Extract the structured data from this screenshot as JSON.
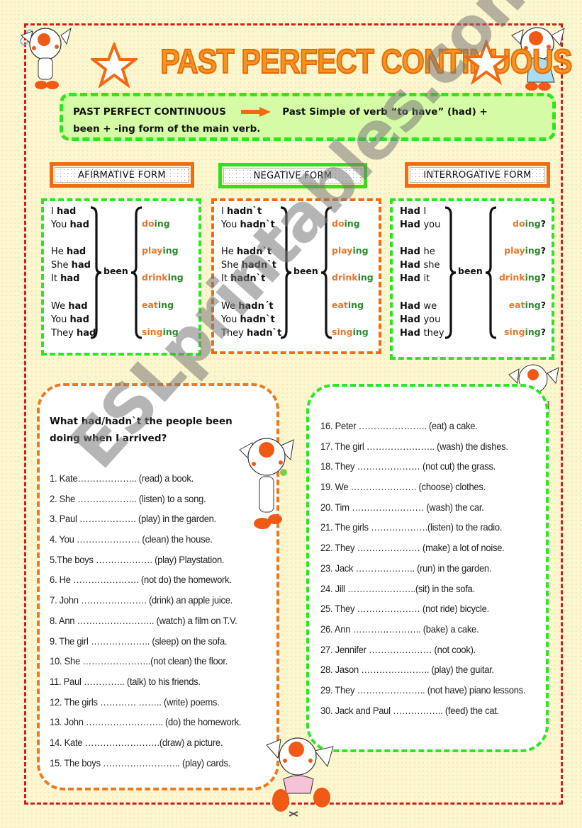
{
  "title": "PAST PERFECT CONTINUOUS",
  "rule": {
    "term": "PAST PERFECT CONTINUOUS",
    "arrow_icon": "right-arrow-icon",
    "definition_part1": "Past Simple of verb “to have” (had) +",
    "definition_part2": "been + -ing form of the main verb."
  },
  "colors": {
    "frame": "#d11f1f",
    "orange": "#f26a11",
    "green": "#2ee620",
    "title": "#f7941d",
    "verb_stem": "#e9772a",
    "verb_ing": "#2b8a2b",
    "rule_bg": "#d6fba6",
    "page_bg": "#fdf7cf"
  },
  "forms": {
    "affirmative": {
      "label": "AFIRMATIVE FORM",
      "subjects": [
        {
          "pronoun": "I",
          "aux": "had"
        },
        {
          "pronoun": "You",
          "aux": "had"
        },
        {
          "pronoun": "He",
          "aux": "had"
        },
        {
          "pronoun": "She",
          "aux": "had"
        },
        {
          "pronoun": "It",
          "aux": "had"
        },
        {
          "pronoun": "We",
          "aux": "had"
        },
        {
          "pronoun": "You",
          "aux": "had"
        },
        {
          "pronoun": "They",
          "aux": "had"
        }
      ],
      "been": "been",
      "verbs": [
        {
          "stem": "do",
          "ing": "ing",
          "q": ""
        },
        {
          "stem": "play",
          "ing": "ing",
          "q": ""
        },
        {
          "stem": "drink",
          "ing": "ing",
          "q": ""
        },
        {
          "stem": "eat",
          "ing": "ing",
          "q": ""
        },
        {
          "stem": "sing",
          "ing": "ing",
          "q": ""
        }
      ]
    },
    "negative": {
      "label": "NEGATIVE FORM",
      "subjects": [
        {
          "pronoun": "I",
          "aux": "hadn`t"
        },
        {
          "pronoun": "You",
          "aux": "hadn`t"
        },
        {
          "pronoun": "He",
          "aux": "hadn`t"
        },
        {
          "pronoun": "She",
          "aux": "hadn`t"
        },
        {
          "pronoun": "It",
          "aux": "hadn`t"
        },
        {
          "pronoun": "We",
          "aux": "hadn´t"
        },
        {
          "pronoun": "You",
          "aux": "hadn`t"
        },
        {
          "pronoun": "They",
          "aux": "hadn`t"
        }
      ],
      "been": "been",
      "verbs": [
        {
          "stem": "do",
          "ing": "ing",
          "q": ""
        },
        {
          "stem": "play",
          "ing": "ing",
          "q": ""
        },
        {
          "stem": "drink",
          "ing": "ing",
          "q": ""
        },
        {
          "stem": "eat",
          "ing": "ing",
          "q": ""
        },
        {
          "stem": "sing",
          "ing": "ing",
          "q": ""
        }
      ]
    },
    "interrogative": {
      "label": "INTERROGATIVE FORM",
      "subjects": [
        {
          "aux": "Had",
          "pronoun": "I"
        },
        {
          "aux": "Had",
          "pronoun": "you"
        },
        {
          "aux": "Had",
          "pronoun": "he"
        },
        {
          "aux": "Had",
          "pronoun": "she"
        },
        {
          "aux": "Had",
          "pronoun": "it"
        },
        {
          "aux": "Had",
          "pronoun": "we"
        },
        {
          "aux": "Had",
          "pronoun": "you"
        },
        {
          "aux": "Had",
          "pronoun": "they"
        }
      ],
      "been": "been",
      "verbs": [
        {
          "stem": "do",
          "ing": "ing",
          "q": "?"
        },
        {
          "stem": "play",
          "ing": "ing",
          "q": "?"
        },
        {
          "stem": "drink",
          "ing": "ing",
          "q": "?"
        },
        {
          "stem": "eat",
          "ing": "ing",
          "q": "?"
        },
        {
          "stem": "sing",
          "ing": "ing",
          "q": "?"
        }
      ]
    }
  },
  "exercise": {
    "instruction": "What had/hadn`t the people been doing when I arrived?",
    "items_left": [
      "1. Kate……………….. (read) a book.",
      "2. She ……………….. (listen) to a song.",
      "3. Paul ………………. (play)  in the garden.",
      "4. You ………………… (clean)  the house.",
      "5.The boys ………………. (play) Playstation.",
      "6. He …………………. (not do) the homework.",
      "7. John …………………. (drink) an apple juice.",
      "8. Ann …………………….. (watch) a film on T.V.",
      "9. The girl ………………..  (sleep) on the sofa.",
      "10. She …………………..(not clean) the floor.",
      "11. Paul …………..  (talk) to his friends.",
      "12. The girls ………… …….. (write) poems.",
      "13. John …………………….. (do) the homework.",
      "14. Kate …………………….(draw) a picture.",
      "15. The boys …………………….. (play) cards."
    ],
    "items_right": [
      "16. Peter …………………..  (eat) a cake.",
      "17. The girl ………………….. (wash) the dishes.",
      "18. They ………………… (not cut) the grass.",
      "19. We ………………….  (choose) clothes.",
      "20. Tim …………………… (wash) the car.",
      "21. The girls ……………….(listen) to the radio.",
      "22. They ………………… (make) a lot of noise.",
      "23. Jack ………………..  (run)  in the garden.",
      "24. Jill …………………..(sit)  in the sofa.",
      "25. They ………………… (not ride) bicycle.",
      "26. Ann …………………..  (bake) a cake.",
      "27. Jennifer ………………… (not cook).",
      "28. Jason …………………..  (play) the guitar.",
      "29. They …………………..  (not have) piano lessons.",
      "30. Jack and Paul …………….. (feed) the cat."
    ]
  },
  "watermark": "ESLprintables.com"
}
